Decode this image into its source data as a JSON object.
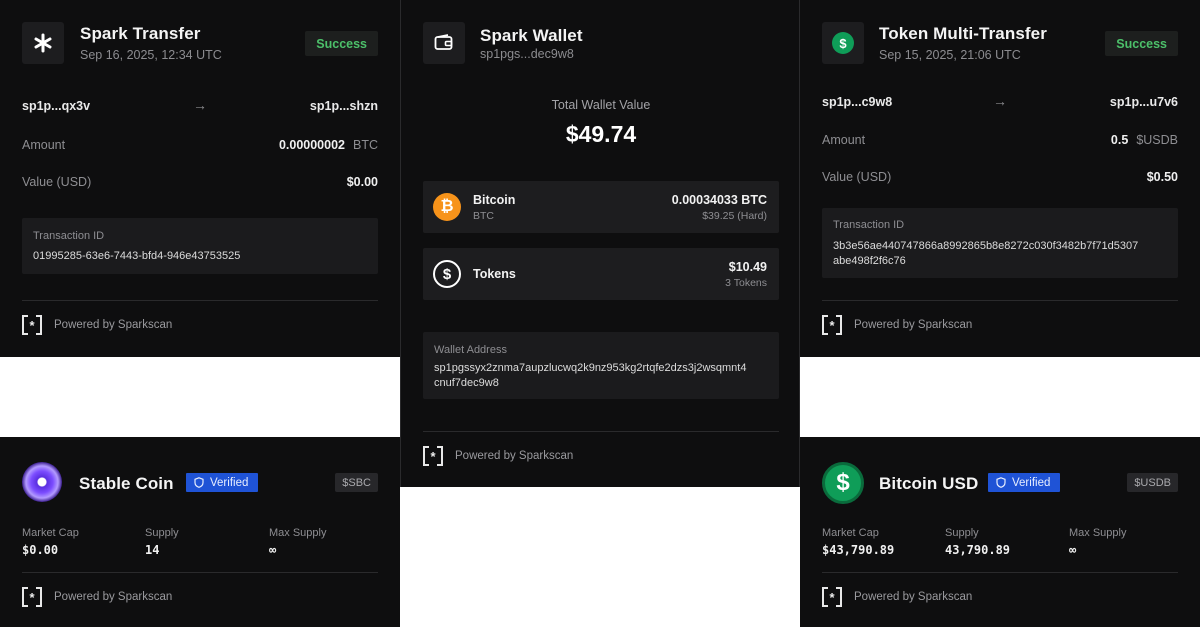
{
  "spark_transfer": {
    "title": "Spark Transfer",
    "date": "Sep 16, 2025, 12:34 UTC",
    "status": "Success",
    "from": "sp1p...qx3v",
    "to": "sp1p...shzn",
    "amount_label": "Amount",
    "amount_value": "0.00000002",
    "amount_unit": "BTC",
    "usd_label": "Value (USD)",
    "usd_value": "$0.00",
    "tx_label": "Transaction ID",
    "tx_id": "01995285-63e6-7443-bfd4-946e43753525",
    "footer": "Powered by Sparkscan"
  },
  "spark_wallet": {
    "title": "Spark Wallet",
    "address_short": "sp1pgs...dec9w8",
    "total_label": "Total Wallet Value",
    "total_value": "$49.74",
    "assets": [
      {
        "name": "Bitcoin",
        "ticker": "BTC",
        "amount": "0.00034033 BTC",
        "sub": "$39.25 (Hard)",
        "icon": "bitcoin-icon"
      },
      {
        "name": "Tokens",
        "amount": "$10.49",
        "sub": "3 Tokens",
        "icon": "dollar-icon"
      }
    ],
    "wallet_address_label": "Wallet Address",
    "wallet_address_line1": "sp1pgssyx2znma7aupzlucwq2k9nz953kg2rtqfe2dzs3j2wsqmnt4",
    "wallet_address_line2": "cnuf7dec9w8",
    "footer": "Powered by Sparkscan"
  },
  "token_multi": {
    "title": "Token Multi-Transfer",
    "date": "Sep 15, 2025, 21:06 UTC",
    "status": "Success",
    "from": "sp1p...c9w8",
    "to": "sp1p...u7v6",
    "amount_label": "Amount",
    "amount_value": "0.5",
    "amount_unit": "$USDB",
    "usd_label": "Value (USD)",
    "usd_value": "$0.50",
    "tx_label": "Transaction ID",
    "tx_line1": "3b3e56ae440747866a8992865b8e8272c030f3482b7f71d5307",
    "tx_line2": "abe498f2f6c76",
    "footer": "Powered by Sparkscan"
  },
  "stable_coin": {
    "name": "Stable Coin",
    "verified": "Verified",
    "ticker": "$SBC",
    "mc_label": "Market Cap",
    "mc_value": "$0.00",
    "supply_label": "Supply",
    "supply_value": "14",
    "max_label": "Max Supply",
    "max_value": "∞",
    "footer": "Powered by Sparkscan"
  },
  "bitcoin_usd": {
    "name": "Bitcoin USD",
    "verified": "Verified",
    "ticker": "$USDB",
    "mc_label": "Market Cap",
    "mc_value": "$43,790.89",
    "supply_label": "Supply",
    "supply_value": "43,790.89",
    "max_label": "Max Supply",
    "max_value": "∞",
    "footer": "Powered by Sparkscan"
  },
  "colors": {
    "card_bg": "#0e0e0f",
    "success": "#4cc06a",
    "verified_bg": "#1f53d6",
    "bitcoin_orange": "#f7931a",
    "usdb_green": "#0f9d58",
    "stable_purple": "#8a5cff"
  }
}
